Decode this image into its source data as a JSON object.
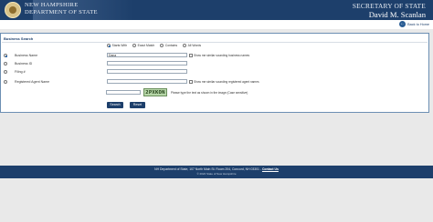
{
  "header": {
    "state_line1": "NEW HAMPSHIRE",
    "state_line2": "DEPARTMENT OF STATE",
    "office_title": "SECRETARY OF STATE",
    "official_name": "David M. Scanlan",
    "back_link": "Back to Home"
  },
  "form": {
    "title": "Business Search",
    "match_options": [
      {
        "label": "Starts With",
        "selected": true
      },
      {
        "label": "Exact Match",
        "selected": false
      },
      {
        "label": "Contains",
        "selected": false
      },
      {
        "label": "All Words",
        "selected": false
      }
    ],
    "rows": [
      {
        "label": "Business Name",
        "selected": true,
        "value": "Dana",
        "checkbox_label": "Show me similar sounding business names"
      },
      {
        "label": "Business ID",
        "selected": false,
        "value": ""
      },
      {
        "label": "Filing #",
        "selected": false,
        "value": ""
      },
      {
        "label": "Registered Agent Name",
        "selected": false,
        "value": "",
        "checkbox_label": "Show me similar sounding registered agent names"
      }
    ],
    "captcha_text": "2PXKON",
    "captcha_help": "Please type the text as shown in the image (Case sensitive)",
    "search_label": "Search",
    "reset_label": "Reset"
  },
  "footer": {
    "address": "NH Department of State, 107 North Main St. Room 204, Concord, NH 03301 - ",
    "contact_label": "Contact Us",
    "copyright": "© 2022 State of New Hampshire"
  },
  "colors": {
    "header_bg": "#1d3f6b",
    "accent": "#1a5ea8",
    "captcha_bg": "#b6d6a8"
  }
}
